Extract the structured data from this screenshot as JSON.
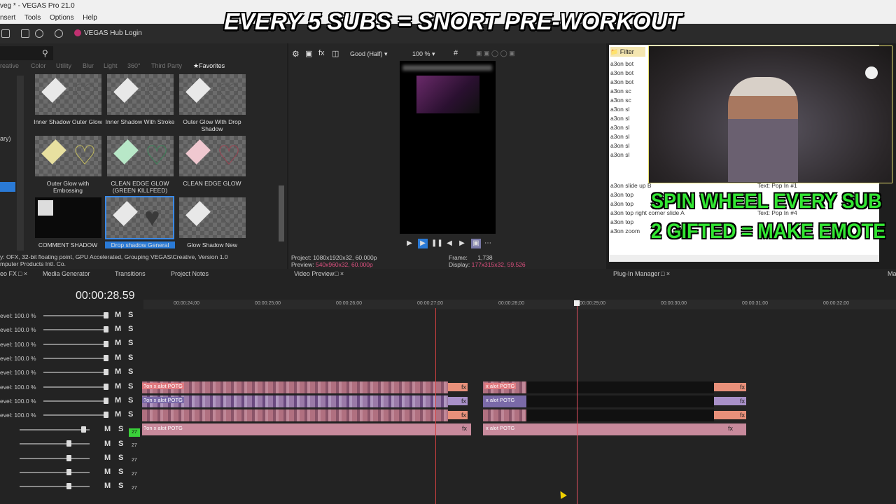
{
  "window": {
    "title": "veg * - VEGAS Pro 21.0"
  },
  "menu": [
    "nsert",
    "Tools",
    "Options",
    "Help"
  ],
  "toolbar": {
    "hub_label": "VEGAS Hub Login"
  },
  "overlays": {
    "top_banner": "EVERY 5 SUBS = SNORT PRE-WORKOUT",
    "green_line1": "SPIN WHEEL EVERY SUB",
    "green_line2": "2 GIFTED = MAKE EMOTE"
  },
  "fx_panel": {
    "tabs": [
      "reative",
      "Color",
      "Utility",
      "Blur",
      "Light",
      "360°",
      "Third Party",
      "Favorites"
    ],
    "side_labels": [
      "ary)"
    ],
    "presets": [
      "Inner Shadow Outer Glow",
      "Inner Shadow With Stroke",
      "Outer Glow With Drop Shadow",
      "Outer Glow with Embossing",
      "CLEAN EDGE GLOW (GREEN KILLFEED)",
      "CLEAN EDGE GLOW",
      "COMMENT SHADOW",
      "Drop shadow General",
      "Glow Shadow New"
    ],
    "info_line1": "y: OFX, 32-bit floating point, GPU Accelerated, Grouping VEGAS\\Creative, Version 1.0",
    "info_line2": "mputer Products Intl. Co."
  },
  "preview": {
    "quality": "Good (Half)",
    "zoom": "100 %",
    "project_label": "Project:",
    "project_value": "1080x1920x32, 60.000p",
    "preview_label": "Preview:",
    "preview_value": "540x960x32, 60.000p",
    "frame_label": "Frame:",
    "frame_value": "1,738",
    "display_label": "Display:",
    "display_value": "177x315x32, 59.526"
  },
  "plugin_panel": {
    "filter_label": "Filter",
    "items": [
      "a3on bot",
      "a3on bot",
      "a3on bot",
      "a3on sc",
      "a3on sc",
      "a3on sl",
      "a3on sl",
      "a3on sl",
      "a3on sl",
      "a3on sl",
      "a3on sl",
      "a3on slide up B",
      "a3on top",
      "a3on top",
      "a3on top right corner slide A",
      "a3on top",
      "a3on zoom"
    ],
    "items_right": [
      "Text: Pop In #1",
      "Text: Pop In #4"
    ]
  },
  "panel_tabs": [
    "eo FX",
    "Media Generator",
    "Transitions",
    "Project Notes",
    "Video Preview",
    "Plug-In Manager",
    "Ma"
  ],
  "timeline": {
    "timecode": "00:00:28.59",
    "ruler": [
      "00:00:24;00",
      "00:00:25;00",
      "00:00:26;00",
      "00:00:27;00",
      "00:00:28;00",
      "00:00:29;00",
      "00:00:30;00",
      "00:00:31;00",
      "00:00:32;00"
    ],
    "track_level": "evel: 100.0 %",
    "mute": "M",
    "solo": "S",
    "clip_name": "?on x alot POTG",
    "clip_name_short": "x alot POTG",
    "audio_marker": "27",
    "fx_label": "fx"
  }
}
